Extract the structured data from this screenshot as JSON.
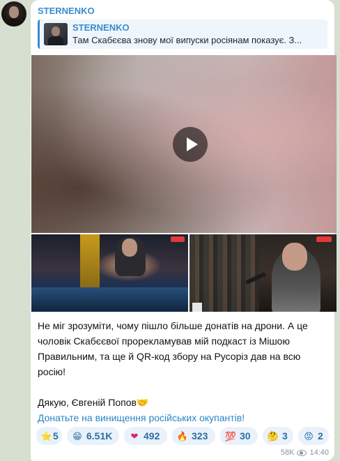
{
  "post": {
    "channel": "STERNENKO",
    "reply": {
      "name": "STERNENKO",
      "text": "Там Скабєєва знову мої випуски росіянам показує. З..."
    },
    "message_lines": [
      "Не міг зрозуміти, чому пішло більше донатів на дрони. А це",
      "чоловік Скабєєвої прорекламував мій подкаст із Мішою",
      "Правильним, та ще й QR-код збору на Русоріз дав на всю",
      "росію!"
    ],
    "signature": "Дякую, Євгеній Попов🤝",
    "donate_link": "Донатьте на винищення російських окупантів!"
  },
  "reactions": [
    {
      "icon": "star-icon",
      "emoji": "⭐",
      "count": "5"
    },
    {
      "icon": "grin-emoji-icon",
      "emoji": "😁",
      "count": "6.51K"
    },
    {
      "icon": "heart-icon",
      "emoji": "❤",
      "count": "492"
    },
    {
      "icon": "fire-icon",
      "emoji": "🔥",
      "count": "323"
    },
    {
      "icon": "hundred-icon",
      "emoji": "💯",
      "count": "30"
    },
    {
      "icon": "thinking-emoji-icon",
      "emoji": "🤔",
      "count": "3"
    },
    {
      "icon": "angry-emoji-icon",
      "emoji": "😡",
      "count": "2"
    }
  ],
  "meta": {
    "views": "58K",
    "time": "14:40"
  },
  "colors": {
    "accent": "#3a8ccf",
    "link": "#2a85c5",
    "reaction_bg": "#e9f2fa",
    "chat_bg": "#d7dfd0"
  }
}
